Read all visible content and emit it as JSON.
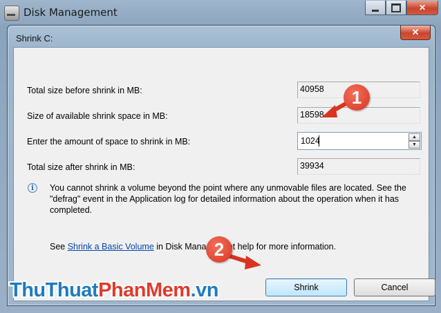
{
  "window": {
    "title": "Disk Management",
    "colors": {
      "close_button": "#c7452d",
      "frame": "#9fb6cc"
    }
  },
  "dialog": {
    "title": "Shrink C:",
    "rows": [
      {
        "label": "Total size before shrink in MB:",
        "value": "40958"
      },
      {
        "label": "Size of available shrink space in MB:",
        "value": "18598"
      },
      {
        "label": "Enter the amount of space to shrink in MB:",
        "value": "1024"
      },
      {
        "label": "Total size after shrink in MB:",
        "value": "39934"
      }
    ],
    "info_icon": "info-icon",
    "info_text": "You cannot shrink a volume beyond the point where any unmovable files are located. See the \"defrag\" event in the Application log for detailed information about the operation when it has completed.",
    "help": {
      "prefix": "See ",
      "link": "Shrink a Basic Volume",
      "suffix": " in Disk Management help for more information."
    },
    "buttons": {
      "shrink": "Shrink",
      "cancel": "Cancel"
    }
  },
  "annotations": {
    "marker_1": "1",
    "marker_2": "2",
    "color": "#d8341f"
  },
  "watermark": {
    "part1": "ThuThuat",
    "part2": "PhanMem",
    "part3": ".vn",
    "color1": "#1f7bbf",
    "color2": "#e03a2c",
    "color3": "#1f7bbf"
  }
}
